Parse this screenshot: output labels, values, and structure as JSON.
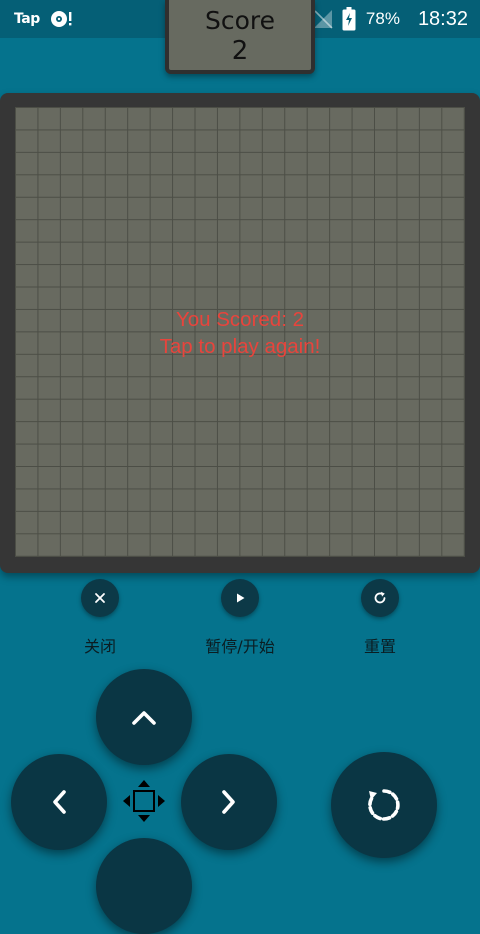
{
  "status_bar": {
    "app_tag": "Tap",
    "battery": "78%",
    "time": "18:32"
  },
  "score": {
    "label": "Score",
    "value": "2"
  },
  "board": {
    "columns": 20,
    "rows": 20,
    "message_line1": "You Scored: 2",
    "message_line2": "Tap to play again!"
  },
  "controls": {
    "close_label": "关闭",
    "pause_start_label": "暂停/开始",
    "reset_label": "重置"
  },
  "colors": {
    "background": "#05738d",
    "grid_cell": "#686a60",
    "message": "#e8443c",
    "button": "#0a3644"
  }
}
